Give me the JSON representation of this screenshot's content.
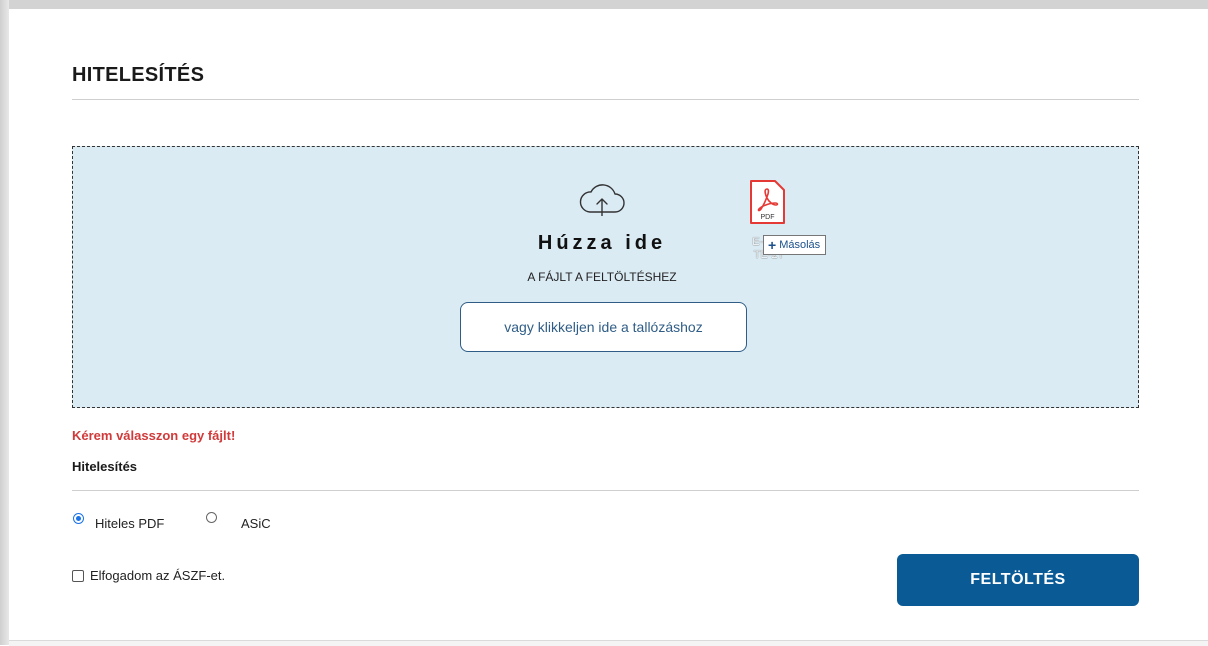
{
  "header": {
    "title": "HITELESÍTÉS"
  },
  "dropzone": {
    "heading": "Húzza ide",
    "subheading": "A FÁJLT A FELTÖLTÉSHEZ",
    "browse_label": "vagy klikkeljen ide a tallózáshoz",
    "drag_preview": {
      "file_type": "PDF",
      "filename_line1": "E-ON_",
      "filename_line2": "TE-2T",
      "tooltip_label": "Másolás",
      "tooltip_icon": "plus-icon"
    }
  },
  "form": {
    "error_message": "Kérem válasszon egy fájlt!",
    "section_label": "Hitelesítés",
    "options": [
      {
        "label": "Hiteles PDF",
        "selected": true
      },
      {
        "label": "ASiC",
        "selected": false
      }
    ],
    "terms_label": "Elfogadom az ÁSZF-et.",
    "terms_checked": false,
    "submit_label": "FELTÖLTÉS"
  },
  "colors": {
    "dropzone_bg": "#daebf4",
    "error": "#d13a3a",
    "primary_button": "#0a5a96",
    "radio_accent": "#1a73e8"
  }
}
